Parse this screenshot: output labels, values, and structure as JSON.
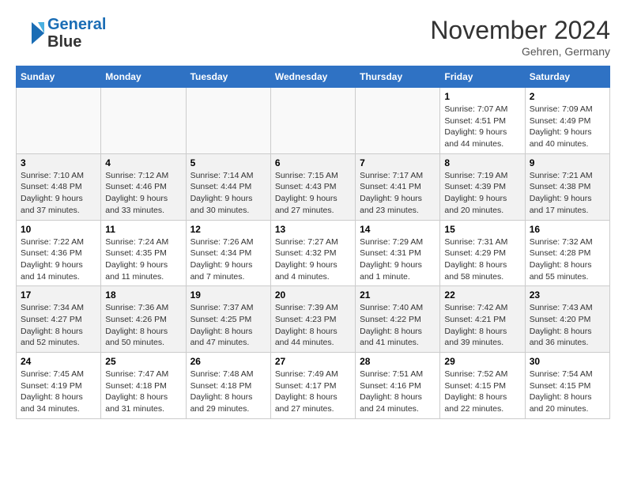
{
  "header": {
    "logo_line1": "General",
    "logo_line2": "Blue",
    "month_title": "November 2024",
    "location": "Gehren, Germany"
  },
  "weekdays": [
    "Sunday",
    "Monday",
    "Tuesday",
    "Wednesday",
    "Thursday",
    "Friday",
    "Saturday"
  ],
  "weeks": [
    [
      {
        "day": "",
        "info": ""
      },
      {
        "day": "",
        "info": ""
      },
      {
        "day": "",
        "info": ""
      },
      {
        "day": "",
        "info": ""
      },
      {
        "day": "",
        "info": ""
      },
      {
        "day": "1",
        "info": "Sunrise: 7:07 AM\nSunset: 4:51 PM\nDaylight: 9 hours\nand 44 minutes."
      },
      {
        "day": "2",
        "info": "Sunrise: 7:09 AM\nSunset: 4:49 PM\nDaylight: 9 hours\nand 40 minutes."
      }
    ],
    [
      {
        "day": "3",
        "info": "Sunrise: 7:10 AM\nSunset: 4:48 PM\nDaylight: 9 hours\nand 37 minutes."
      },
      {
        "day": "4",
        "info": "Sunrise: 7:12 AM\nSunset: 4:46 PM\nDaylight: 9 hours\nand 33 minutes."
      },
      {
        "day": "5",
        "info": "Sunrise: 7:14 AM\nSunset: 4:44 PM\nDaylight: 9 hours\nand 30 minutes."
      },
      {
        "day": "6",
        "info": "Sunrise: 7:15 AM\nSunset: 4:43 PM\nDaylight: 9 hours\nand 27 minutes."
      },
      {
        "day": "7",
        "info": "Sunrise: 7:17 AM\nSunset: 4:41 PM\nDaylight: 9 hours\nand 23 minutes."
      },
      {
        "day": "8",
        "info": "Sunrise: 7:19 AM\nSunset: 4:39 PM\nDaylight: 9 hours\nand 20 minutes."
      },
      {
        "day": "9",
        "info": "Sunrise: 7:21 AM\nSunset: 4:38 PM\nDaylight: 9 hours\nand 17 minutes."
      }
    ],
    [
      {
        "day": "10",
        "info": "Sunrise: 7:22 AM\nSunset: 4:36 PM\nDaylight: 9 hours\nand 14 minutes."
      },
      {
        "day": "11",
        "info": "Sunrise: 7:24 AM\nSunset: 4:35 PM\nDaylight: 9 hours\nand 11 minutes."
      },
      {
        "day": "12",
        "info": "Sunrise: 7:26 AM\nSunset: 4:34 PM\nDaylight: 9 hours\nand 7 minutes."
      },
      {
        "day": "13",
        "info": "Sunrise: 7:27 AM\nSunset: 4:32 PM\nDaylight: 9 hours\nand 4 minutes."
      },
      {
        "day": "14",
        "info": "Sunrise: 7:29 AM\nSunset: 4:31 PM\nDaylight: 9 hours\nand 1 minute."
      },
      {
        "day": "15",
        "info": "Sunrise: 7:31 AM\nSunset: 4:29 PM\nDaylight: 8 hours\nand 58 minutes."
      },
      {
        "day": "16",
        "info": "Sunrise: 7:32 AM\nSunset: 4:28 PM\nDaylight: 8 hours\nand 55 minutes."
      }
    ],
    [
      {
        "day": "17",
        "info": "Sunrise: 7:34 AM\nSunset: 4:27 PM\nDaylight: 8 hours\nand 52 minutes."
      },
      {
        "day": "18",
        "info": "Sunrise: 7:36 AM\nSunset: 4:26 PM\nDaylight: 8 hours\nand 50 minutes."
      },
      {
        "day": "19",
        "info": "Sunrise: 7:37 AM\nSunset: 4:25 PM\nDaylight: 8 hours\nand 47 minutes."
      },
      {
        "day": "20",
        "info": "Sunrise: 7:39 AM\nSunset: 4:23 PM\nDaylight: 8 hours\nand 44 minutes."
      },
      {
        "day": "21",
        "info": "Sunrise: 7:40 AM\nSunset: 4:22 PM\nDaylight: 8 hours\nand 41 minutes."
      },
      {
        "day": "22",
        "info": "Sunrise: 7:42 AM\nSunset: 4:21 PM\nDaylight: 8 hours\nand 39 minutes."
      },
      {
        "day": "23",
        "info": "Sunrise: 7:43 AM\nSunset: 4:20 PM\nDaylight: 8 hours\nand 36 minutes."
      }
    ],
    [
      {
        "day": "24",
        "info": "Sunrise: 7:45 AM\nSunset: 4:19 PM\nDaylight: 8 hours\nand 34 minutes."
      },
      {
        "day": "25",
        "info": "Sunrise: 7:47 AM\nSunset: 4:18 PM\nDaylight: 8 hours\nand 31 minutes."
      },
      {
        "day": "26",
        "info": "Sunrise: 7:48 AM\nSunset: 4:18 PM\nDaylight: 8 hours\nand 29 minutes."
      },
      {
        "day": "27",
        "info": "Sunrise: 7:49 AM\nSunset: 4:17 PM\nDaylight: 8 hours\nand 27 minutes."
      },
      {
        "day": "28",
        "info": "Sunrise: 7:51 AM\nSunset: 4:16 PM\nDaylight: 8 hours\nand 24 minutes."
      },
      {
        "day": "29",
        "info": "Sunrise: 7:52 AM\nSunset: 4:15 PM\nDaylight: 8 hours\nand 22 minutes."
      },
      {
        "day": "30",
        "info": "Sunrise: 7:54 AM\nSunset: 4:15 PM\nDaylight: 8 hours\nand 20 minutes."
      }
    ]
  ]
}
